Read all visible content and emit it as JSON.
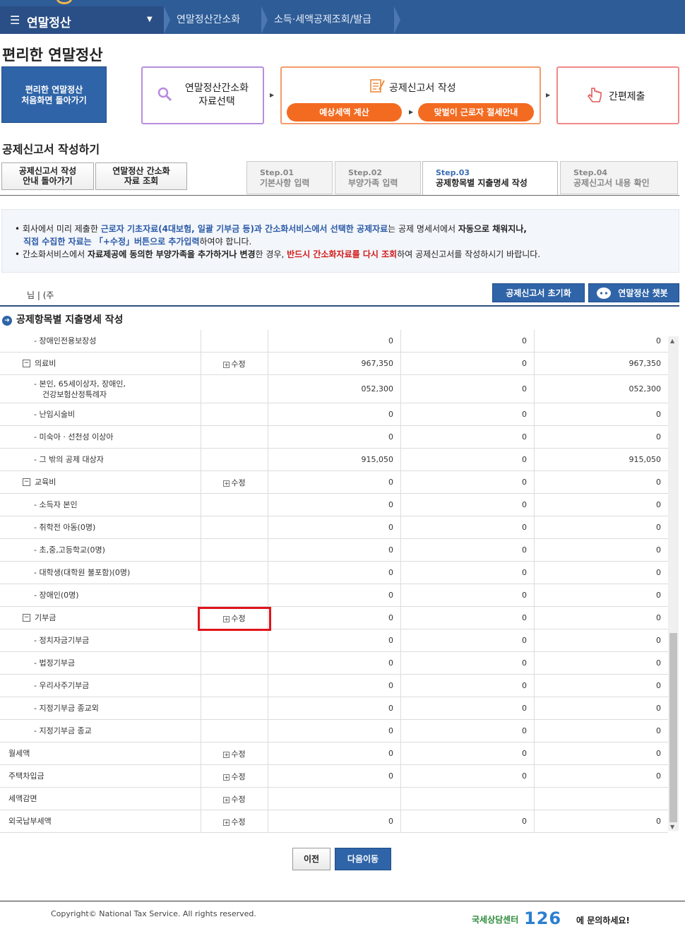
{
  "nav": {
    "menu_label": "연말정산",
    "crumb1": "연말정산간소화",
    "crumb2": "소득·세액공제조회/발급"
  },
  "page_title": "편리한 연말정산",
  "process": {
    "home_line1": "편리한 연말정산",
    "home_line2": "처음화면 돌아가기",
    "box1_line1": "연말정산간소화",
    "box1_line2": "자료선택",
    "box2_title": "공제신고서 작성",
    "pill1": "예상세액 계산",
    "pill2": "맞벌이 근로자 절세안내",
    "box3_title": "간편제출"
  },
  "section_title": "공제신고서 작성하기",
  "guide_buttons": [
    {
      "line1": "공제신고서 작성",
      "line2": "안내 돌아가기"
    },
    {
      "line1": "연말정산 간소화",
      "line2": "자료 조회"
    }
  ],
  "steps": [
    {
      "num": "Step.01",
      "label": "기본사항 입력"
    },
    {
      "num": "Step.02",
      "label": "부양가족 입력"
    },
    {
      "num": "Step.03",
      "label": "공제항목별 지출명세 작성"
    },
    {
      "num": "Step.04",
      "label": "공제신고서 내용 확인"
    }
  ],
  "notice": {
    "l1a": "• 회사에서 미리 제출한 ",
    "l1b": "근로자 기초자료(4대보험, 일괄 기부금 등)과 간소화서비스에서 선택한 공제자료",
    "l1c": "는 공제 명세서에서 ",
    "l1d": "자동으로 채워지나,",
    "l2a": "직접 수집한 자료는 「+수정」버튼으로 추가입력",
    "l2b": "하여야 합니다.",
    "l3a": "• 간소화서비스에서 ",
    "l3b": "자료제공에 동의한 부양가족을 추가하거나 변경",
    "l3c": "한 경우, ",
    "l3d": "반드시 간소화자료를 다시 조회",
    "l3e": "하여 공제신고서를 작성하시기 바랍니다."
  },
  "subinfo": "님 | (주",
  "buttons": {
    "reset": "공제신고서 초기화",
    "chatbot": "연말정산 챗봇",
    "prev": "이전",
    "next": "다음이동"
  },
  "table_title": "공제항목별 지출명세 작성",
  "edit_label": "수정",
  "rows": [
    {
      "label": "- 장애인전용보장성",
      "indent": 2,
      "edit": false,
      "v": [
        "0",
        "0",
        "0"
      ]
    },
    {
      "label": "의료비",
      "indent": 1,
      "edit": true,
      "v": [
        "967,350",
        "0",
        "967,350"
      ]
    },
    {
      "label": "- 본인, 65세이상자, 장애인,",
      "label2": "건강보험산정특례자",
      "indent": 2,
      "edit": false,
      "v": [
        "052,300",
        "0",
        "052,300"
      ]
    },
    {
      "label": "- 난임시술비",
      "indent": 2,
      "edit": false,
      "v": [
        "0",
        "0",
        "0"
      ]
    },
    {
      "label": "- 미숙아 · 선천성 이상아",
      "indent": 2,
      "edit": false,
      "v": [
        "0",
        "0",
        "0"
      ]
    },
    {
      "label": "- 그 밖의 공제 대상자",
      "indent": 2,
      "edit": false,
      "v": [
        "915,050",
        "0",
        "915,050"
      ]
    },
    {
      "label": "교육비",
      "indent": 1,
      "edit": true,
      "v": [
        "0",
        "0",
        "0"
      ]
    },
    {
      "label": "- 소득자 본인",
      "indent": 2,
      "edit": false,
      "v": [
        "0",
        "0",
        "0"
      ]
    },
    {
      "label": "- 취학전 아동(0명)",
      "indent": 2,
      "edit": false,
      "v": [
        "0",
        "0",
        "0"
      ]
    },
    {
      "label": "- 초,중,고등학교(0명)",
      "indent": 2,
      "edit": false,
      "v": [
        "0",
        "0",
        "0"
      ]
    },
    {
      "label": "- 대학생(대학원 불포함)(0명)",
      "indent": 2,
      "edit": false,
      "v": [
        "0",
        "0",
        "0"
      ]
    },
    {
      "label": "- 장애인(0명)",
      "indent": 2,
      "edit": false,
      "v": [
        "0",
        "0",
        "0"
      ]
    },
    {
      "label": "기부금",
      "indent": 1,
      "edit": true,
      "v": [
        "0",
        "0",
        "0"
      ]
    },
    {
      "label": "- 정치자금기부금",
      "indent": 2,
      "edit": false,
      "v": [
        "0",
        "0",
        "0"
      ]
    },
    {
      "label": "- 법정기부금",
      "indent": 2,
      "edit": false,
      "v": [
        "0",
        "0",
        "0"
      ]
    },
    {
      "label": "- 우리사주기부금",
      "indent": 2,
      "edit": false,
      "v": [
        "0",
        "0",
        "0"
      ]
    },
    {
      "label": "- 지정기부금 종교외",
      "indent": 2,
      "edit": false,
      "v": [
        "0",
        "0",
        "0"
      ]
    },
    {
      "label": "- 지정기부금 종교",
      "indent": 2,
      "edit": false,
      "v": [
        "0",
        "0",
        "0"
      ]
    },
    {
      "label": "월세액",
      "indent": 0,
      "edit": true,
      "v": [
        "0",
        "0",
        "0"
      ]
    },
    {
      "label": "주택차입금",
      "indent": 0,
      "edit": true,
      "v": [
        "0",
        "0",
        "0"
      ]
    },
    {
      "label": "세액감면",
      "indent": 0,
      "edit": true,
      "v": [
        "",
        "",
        ""
      ]
    },
    {
      "label": "외국납부세액",
      "indent": 0,
      "edit": true,
      "v": [
        "0",
        "0",
        "0"
      ]
    }
  ],
  "footer": {
    "copyright": "Copyright© National Tax Service. All rights reserved.",
    "center": "국세상담센터",
    "number": "126",
    "ask": "에 문의하세요!"
  }
}
